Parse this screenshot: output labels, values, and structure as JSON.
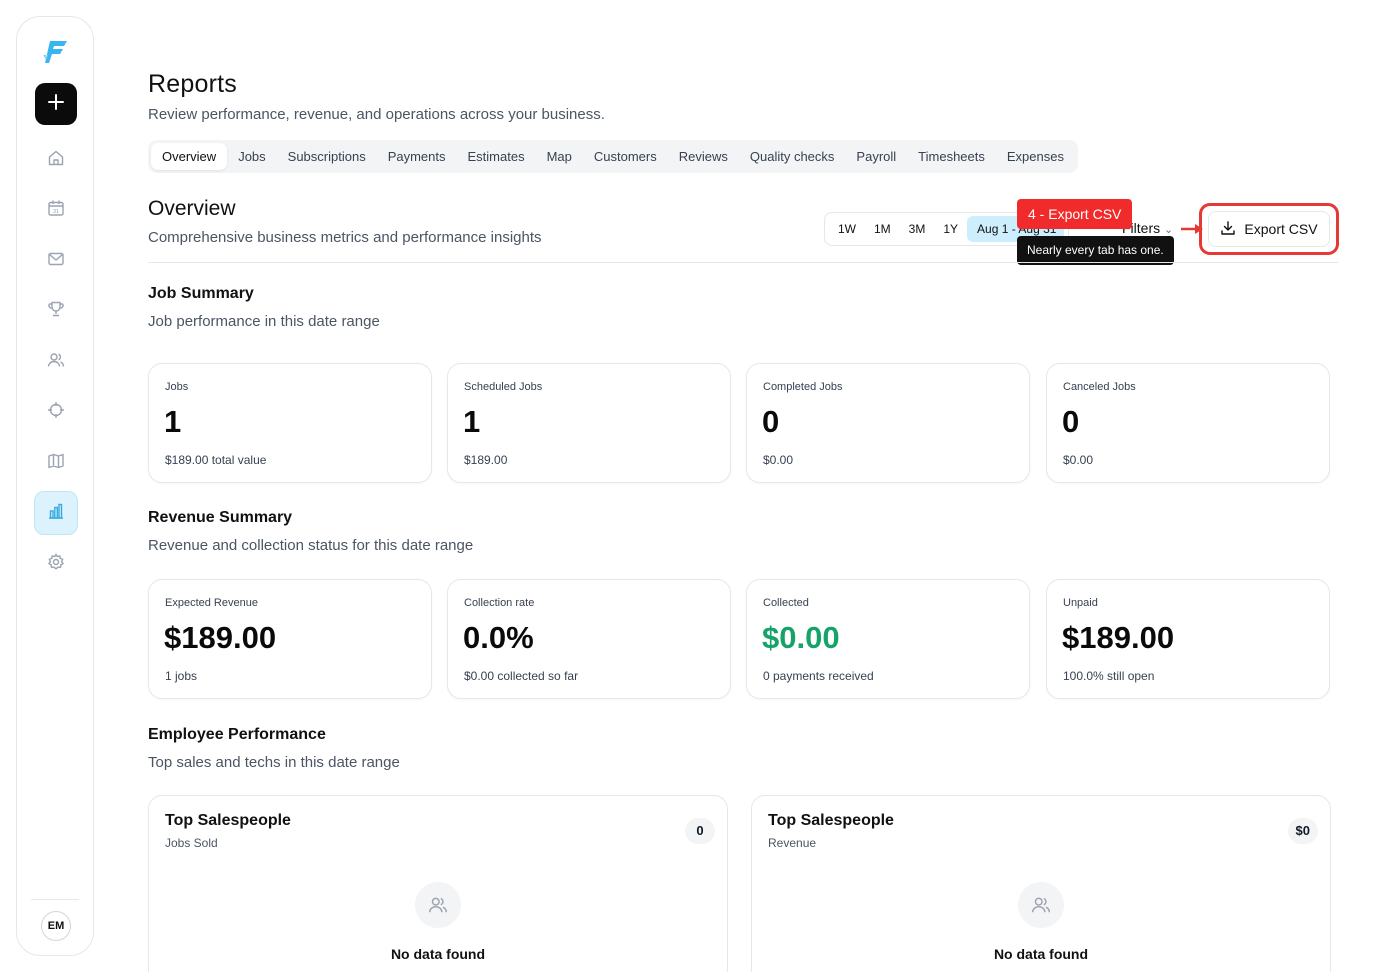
{
  "sidebar": {
    "logo_icon": "brand-logo-icon",
    "add_icon": "plus-icon",
    "nav": [
      {
        "id": "home",
        "icon": "home-icon"
      },
      {
        "id": "calendar",
        "icon": "calendar-icon",
        "label": "31"
      },
      {
        "id": "inbox",
        "icon": "mail-icon"
      },
      {
        "id": "rewards",
        "icon": "trophy-icon"
      },
      {
        "id": "customers",
        "icon": "users-icon"
      },
      {
        "id": "dispatch",
        "icon": "crosshair-icon"
      },
      {
        "id": "map",
        "icon": "map-icon"
      },
      {
        "id": "reports",
        "icon": "bar-chart-icon",
        "active": true
      },
      {
        "id": "settings",
        "icon": "gear-icon"
      }
    ],
    "avatar_initials": "EM"
  },
  "header": {
    "title": "Reports",
    "subtitle": "Review performance, revenue, and operations across your business."
  },
  "tabs": [
    "Overview",
    "Jobs",
    "Subscriptions",
    "Payments",
    "Estimates",
    "Map",
    "Customers",
    "Reviews",
    "Quality checks",
    "Payroll",
    "Timesheets",
    "Expenses"
  ],
  "active_tab": "Overview",
  "overview": {
    "title": "Overview",
    "subtitle": "Comprehensive business metrics and performance insights"
  },
  "range": {
    "options": [
      "1W",
      "1M",
      "3M",
      "1Y"
    ],
    "date_label": "Aug 1 - Aug 31",
    "filters_label": "Filters"
  },
  "export": {
    "label": "Export CSV",
    "badge": "4 - Export CSV",
    "tooltip": "Nearly every tab has one.",
    "highlight_color": "#e53935"
  },
  "job_summary": {
    "title": "Job Summary",
    "subtitle": "Job performance in this date range",
    "cards": [
      {
        "label": "Jobs",
        "value": "1",
        "sub": "$189.00 total value"
      },
      {
        "label": "Scheduled Jobs",
        "value": "1",
        "sub": "$189.00"
      },
      {
        "label": "Completed Jobs",
        "value": "0",
        "sub": "$0.00"
      },
      {
        "label": "Canceled Jobs",
        "value": "0",
        "sub": "$0.00"
      }
    ]
  },
  "revenue_summary": {
    "title": "Revenue Summary",
    "subtitle": "Revenue and collection status for this date range",
    "cards": [
      {
        "label": "Expected Revenue",
        "value": "$189.00",
        "sub": "1 jobs"
      },
      {
        "label": "Collection rate",
        "value": "0.0%",
        "sub": "$0.00 collected so far"
      },
      {
        "label": "Collected",
        "value": "$0.00",
        "sub": "0 payments received",
        "value_color": "#16a36a"
      },
      {
        "label": "Unpaid",
        "value": "$189.00",
        "sub": "100.0% still open"
      }
    ]
  },
  "employee_performance": {
    "title": "Employee Performance",
    "subtitle": "Top sales and techs in this date range",
    "panels": [
      {
        "title": "Top Salespeople",
        "subtitle": "Jobs Sold",
        "count": "0",
        "empty_text": "No data found",
        "empty_icon": "users-icon"
      },
      {
        "title": "Top Salespeople",
        "subtitle": "Revenue",
        "count": "$0",
        "empty_text": "No data found",
        "empty_icon": "users-icon"
      }
    ]
  }
}
